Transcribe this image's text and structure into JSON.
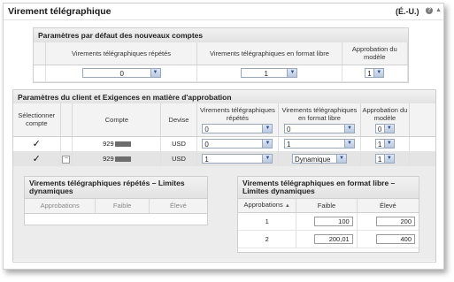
{
  "header": {
    "title": "Virement télégraphique",
    "region": "(É.-U.)",
    "help_icon": "help-icon",
    "collapse_icon": "collapse-icon"
  },
  "defaults_section": {
    "title": "Paramètres par défaut des nouveaux comptes",
    "columns": [
      "Virements télégraphiques répétés",
      "Virements télégraphiques en format libre",
      "Approbation du modèle"
    ],
    "values": [
      "0",
      "1",
      "1"
    ]
  },
  "client_section": {
    "title": "Paramètres du client et Exigences en matière d'approbation",
    "columns": [
      "Sélectionner compte",
      "Compte",
      "Devise",
      "Virements télégraphiques répétés",
      "Virements télégraphiques en format libre",
      "Approbation du modèle"
    ],
    "header_values": [
      "0",
      "0",
      "0"
    ],
    "rows": [
      {
        "select": "✓",
        "account": "929",
        "currency": "USD",
        "repetitive": "0",
        "freeform": "1",
        "approval": "1"
      },
      {
        "select": "✓",
        "account": "929",
        "currency": "USD",
        "repetitive": "1",
        "freeform": "Dynamique",
        "approval": "1"
      }
    ]
  },
  "repetitive_limits": {
    "title": "Virements télégraphiques répétés – Limites dynamiques",
    "columns": [
      "Approbations",
      "Faible",
      "Élevé"
    ]
  },
  "freeform_limits": {
    "title": "Virements télégraphiques en format libre – Limites dynamiques",
    "columns": [
      "Approbations",
      "Faible",
      "Élevé"
    ],
    "rows": [
      {
        "approvals": "1",
        "low": "100",
        "high": "200"
      },
      {
        "approvals": "2",
        "low": "200,01",
        "high": "400"
      }
    ]
  },
  "colors": {
    "accent": "#2f4e86",
    "header_bg": "#e6e6e6"
  }
}
